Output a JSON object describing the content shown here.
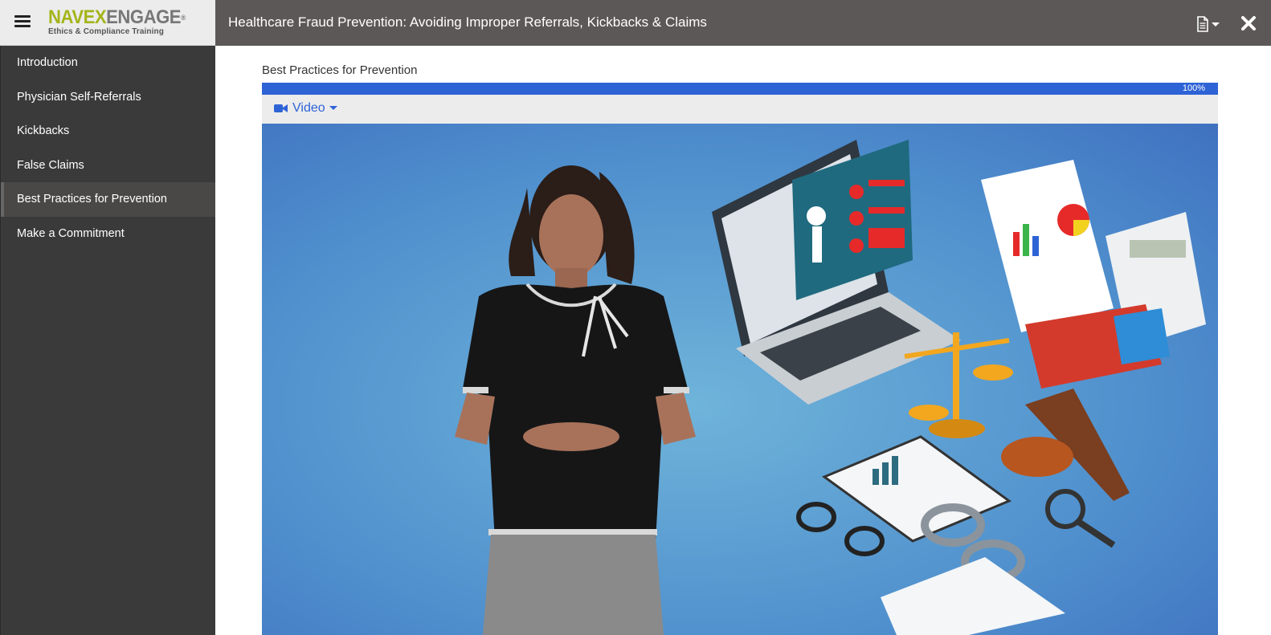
{
  "header": {
    "logo_navex": "NAVEX",
    "logo_engage": "ENGAGE",
    "logo_reg": "®",
    "logo_tagline": "Ethics & Compliance Training",
    "course_title": "Healthcare Fraud Prevention: Avoiding Improper Referrals, Kickbacks & Claims"
  },
  "sidebar": {
    "items": [
      {
        "label": "Introduction"
      },
      {
        "label": "Physician Self-Referrals"
      },
      {
        "label": "Kickbacks"
      },
      {
        "label": "False Claims"
      },
      {
        "label": "Best Practices for Prevention",
        "active": true
      },
      {
        "label": "Make a Commitment"
      }
    ]
  },
  "main": {
    "section_title": "Best Practices for Prevention",
    "progress": {
      "value": 100,
      "label": "100%"
    },
    "media_select": {
      "label": "Video"
    }
  },
  "colors": {
    "accent": "#2e63d6",
    "topbar": "#5c5857",
    "sidebar": "#3b3a3a",
    "logo_green": "#a4b41a"
  }
}
